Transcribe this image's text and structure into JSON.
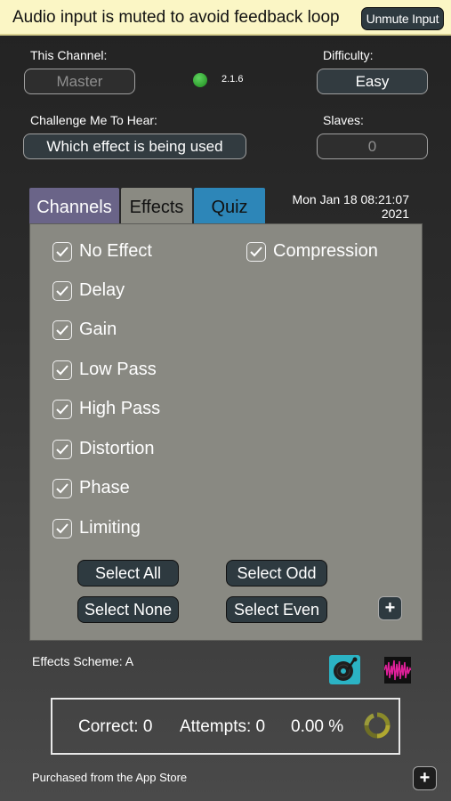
{
  "banner": {
    "message": "Audio input is muted to avoid feedback loop",
    "unmute_label": "Unmute Input"
  },
  "channel": {
    "label": "This Channel:",
    "value": "Master",
    "version": "2.1.6"
  },
  "difficulty": {
    "label": "Difficulty:",
    "value": "Easy"
  },
  "challenge": {
    "label": "Challenge Me To Hear:",
    "value": "Which effect is being used"
  },
  "slaves": {
    "label": "Slaves:",
    "value": "0"
  },
  "tabs": [
    {
      "label": "Channels"
    },
    {
      "label": "Effects"
    },
    {
      "label": "Quiz"
    }
  ],
  "datetime": {
    "line1": "Mon Jan 18 08:21:07",
    "line2": "2021"
  },
  "effects": [
    {
      "label": "No Effect",
      "checked": true
    },
    {
      "label": "Compression",
      "checked": true
    },
    {
      "label": "Delay",
      "checked": true
    },
    {
      "label": "Gain",
      "checked": true
    },
    {
      "label": "Low Pass",
      "checked": true
    },
    {
      "label": "High Pass",
      "checked": true
    },
    {
      "label": "Distortion",
      "checked": true
    },
    {
      "label": "Phase",
      "checked": true
    },
    {
      "label": "Limiting",
      "checked": true
    }
  ],
  "buttons": {
    "select_all": "Select All",
    "select_odd": "Select Odd",
    "select_none": "Select None",
    "select_even": "Select Even",
    "plus": "+"
  },
  "scheme": {
    "text": "Effects Scheme: A"
  },
  "score": {
    "correct": "Correct: 0",
    "attempts": "Attempts: 0",
    "percent": "0.00 %"
  },
  "footer": {
    "purchased": "Purchased from the App Store",
    "plus": "+"
  },
  "icons": [
    "vinyl-record-icon",
    "waveform-icon",
    "refresh-spinner-icon",
    "check-icon",
    "plus-icon"
  ],
  "colors": {
    "banner_bg": "#fbf6c5",
    "button_bg": "#2e3a40",
    "panel_bg": "#898982",
    "tab_channels": "#6a6488",
    "tab_effects": "#8a8a82",
    "tab_quiz": "#2d86b8",
    "led_green": "#3bb33b",
    "vinyl_cyan": "#2bb3c4",
    "wave_magenta": "#e0209a"
  }
}
